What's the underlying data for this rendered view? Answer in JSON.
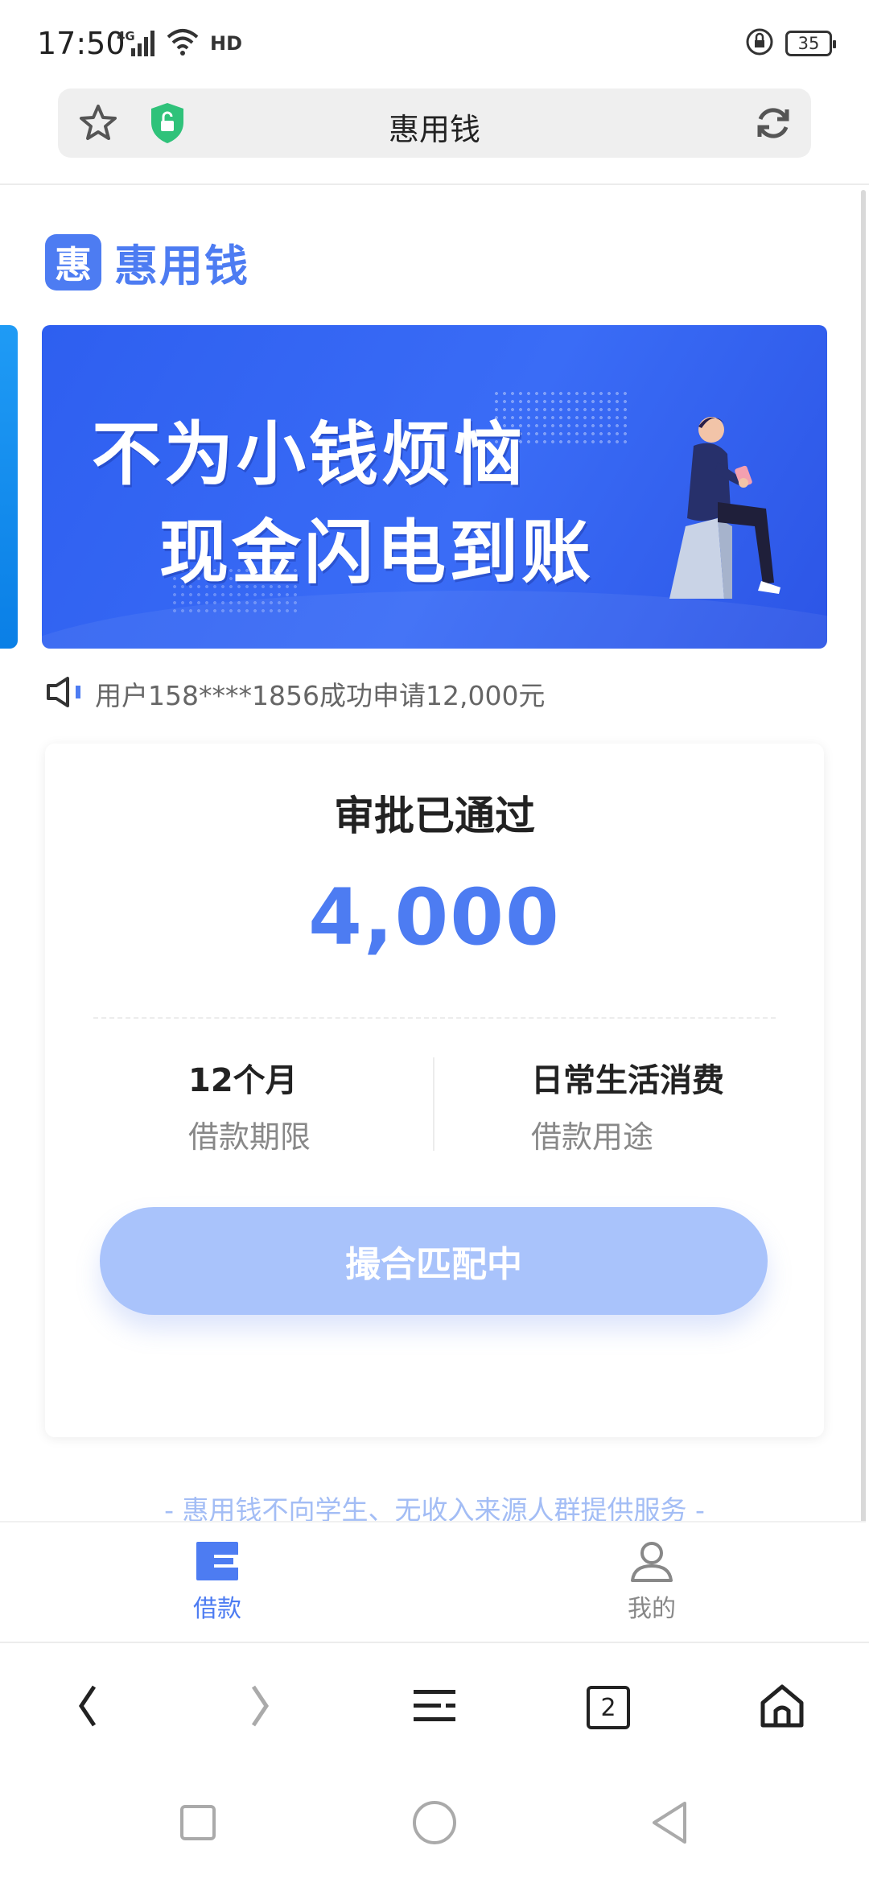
{
  "status_bar": {
    "time": "17:50",
    "network": "4G",
    "hd": "HD",
    "battery": "35"
  },
  "browser": {
    "page_title": "惠用钱",
    "tab_count": "2"
  },
  "app": {
    "logo_mark": "惠",
    "logo_text": "惠用钱",
    "banner": {
      "line1": "不为小钱烦恼",
      "line2": "现金闪电到账"
    },
    "notice": "用户158****1856成功申请12,000元",
    "card": {
      "title": "审批已通过",
      "amount": "4,000",
      "term_value": "12个月",
      "term_label": "借款期限",
      "purpose_value": "日常生活消费",
      "purpose_label": "借款用途",
      "button_label": "撮合匹配中"
    },
    "disclaimer": "- 惠用钱不向学生、无收入来源人群提供服务 -",
    "tabs": [
      {
        "label": "借款",
        "icon": "wallet-icon",
        "active": true
      },
      {
        "label": "我的",
        "icon": "user-icon",
        "active": false
      }
    ]
  },
  "colors": {
    "brand": "#4d7cf2",
    "button_disabled": "#a9c3fb",
    "disclaimer": "#a3bdf5",
    "banner": "#3a6cf6"
  }
}
